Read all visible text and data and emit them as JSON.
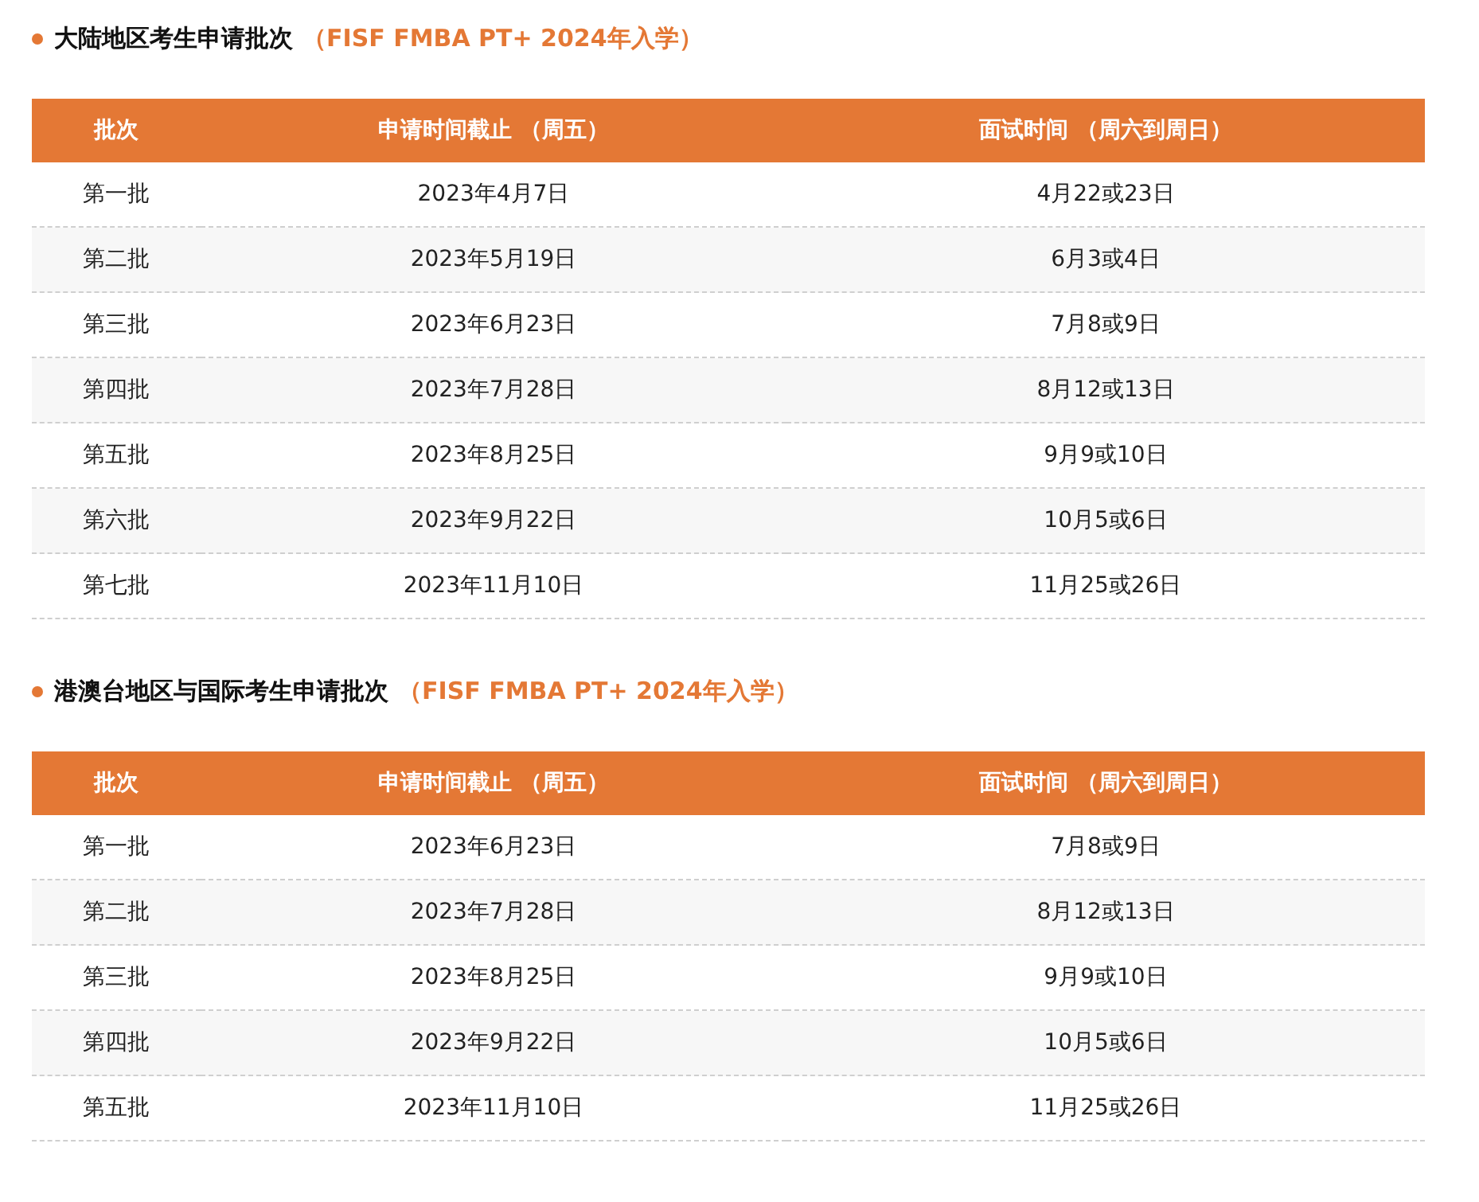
{
  "sections": [
    {
      "title": "大陆地区考生申请批次",
      "subtitle": "（FISF FMBA PT+ 2024年入学）",
      "columns": [
        "批次",
        "申请时间截止 （周五）",
        "面试时间 （周六到周日）"
      ],
      "rows": [
        [
          "第一批",
          "2023年4月7日",
          "4月22或23日"
        ],
        [
          "第二批",
          "2023年5月19日",
          "6月3或4日"
        ],
        [
          "第三批",
          "2023年6月23日",
          "7月8或9日"
        ],
        [
          "第四批",
          "2023年7月28日",
          "8月12或13日"
        ],
        [
          "第五批",
          "2023年8月25日",
          "9月9或10日"
        ],
        [
          "第六批",
          "2023年9月22日",
          "10月5或6日"
        ],
        [
          "第七批",
          "2023年11月10日",
          "11月25或26日"
        ]
      ]
    },
    {
      "title": "港澳台地区与国际考生申请批次",
      "subtitle": "（FISF FMBA PT+ 2024年入学）",
      "columns": [
        "批次",
        "申请时间截止 （周五）",
        "面试时间 （周六到周日）"
      ],
      "rows": [
        [
          "第一批",
          "2023年6月23日",
          "7月8或9日"
        ],
        [
          "第二批",
          "2023年7月28日",
          "8月12或13日"
        ],
        [
          "第三批",
          "2023年8月25日",
          "9月9或10日"
        ],
        [
          "第四批",
          "2023年9月22日",
          "10月5或6日"
        ],
        [
          "第五批",
          "2023年11月10日",
          "11月25或26日"
        ]
      ]
    }
  ]
}
